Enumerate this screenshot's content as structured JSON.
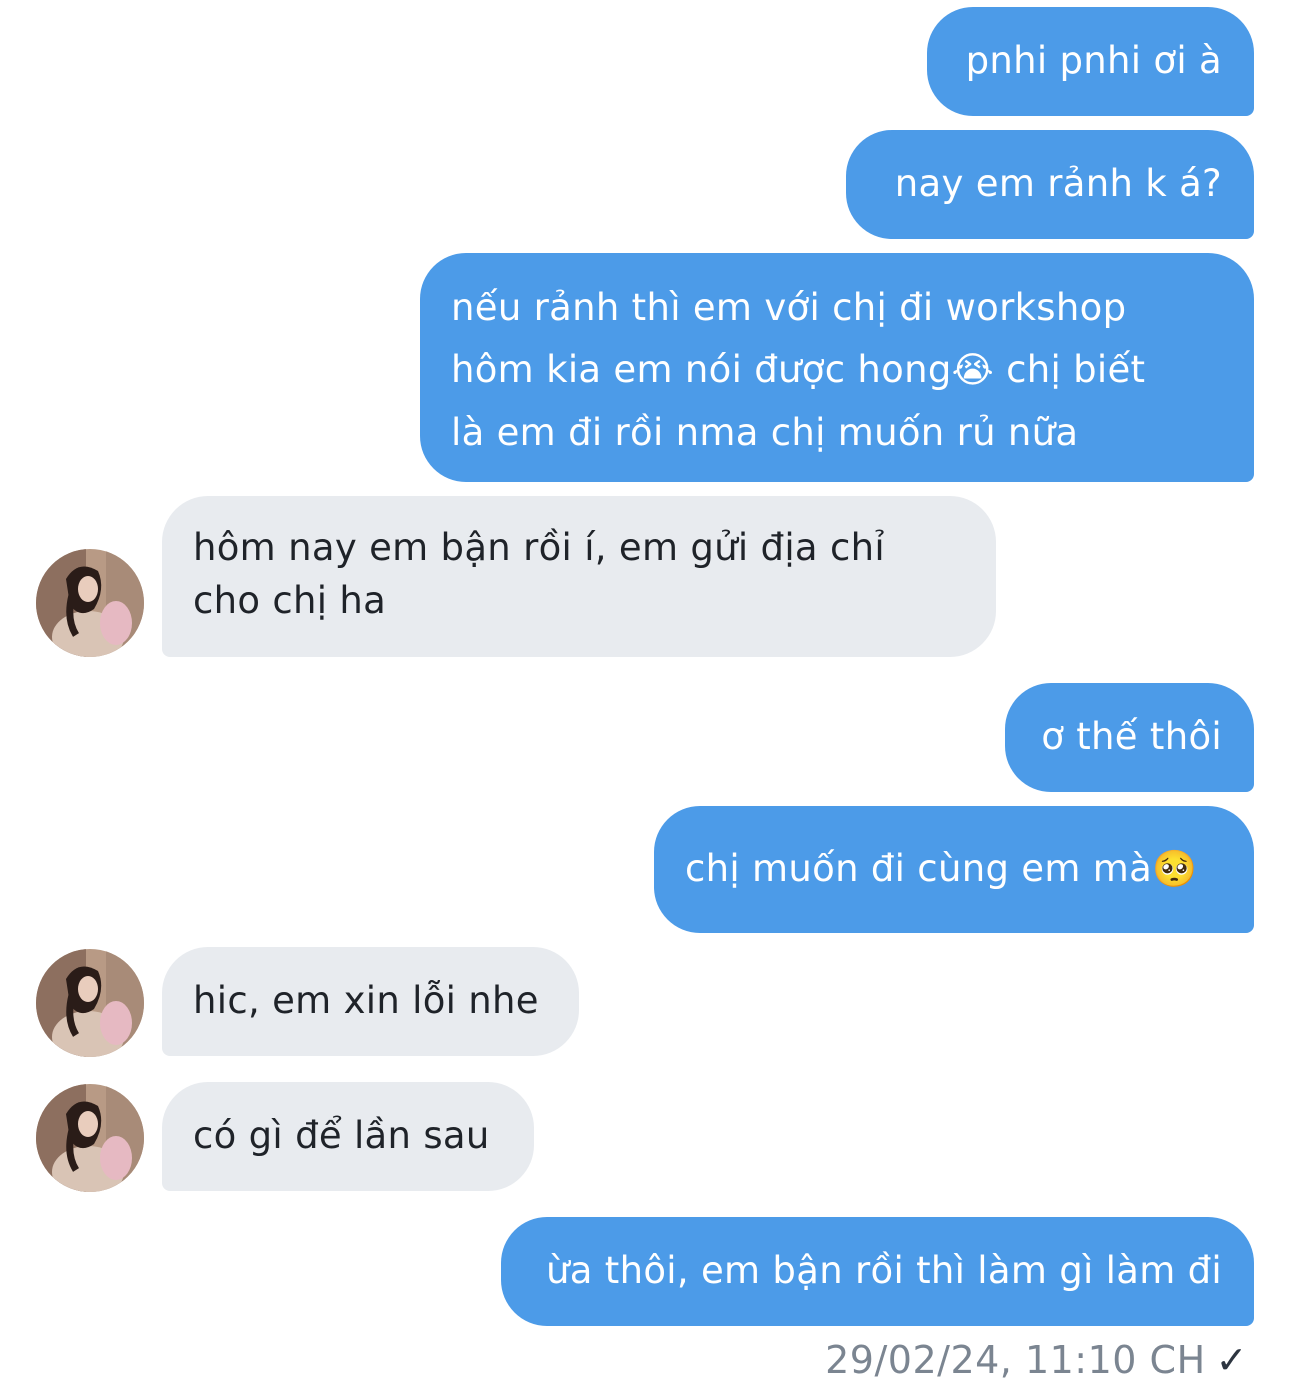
{
  "messages": [
    {
      "from": "me",
      "text": "pnhi pnhi ơi à"
    },
    {
      "from": "me",
      "text": "nay em rảnh k á?"
    },
    {
      "from": "me",
      "lines": [
        "nếu rảnh thì em với chị đi workshop",
        "hôm kia em nói được hong",
        "  chị biết",
        "là em đi rồi nma chị muốn rủ nữa"
      ],
      "emoji": "😭"
    },
    {
      "from": "them",
      "lines": [
        "hôm nay em bận rồi í, em gửi địa chỉ",
        "cho chị ha"
      ]
    },
    {
      "from": "me",
      "text": "ơ thế thôi"
    },
    {
      "from": "me",
      "text": "chị muốn đi cùng em mà",
      "emoji": "🥺"
    },
    {
      "from": "them",
      "text": "hic, em xin lỗi nhe"
    },
    {
      "from": "them",
      "text": "có gì để lần sau"
    },
    {
      "from": "me",
      "text": "ừa thôi, em bận rồi thì làm gì làm đi"
    }
  ],
  "footer": {
    "timestamp": "29/02/24, 11:10 CH",
    "status_icon": "✓"
  },
  "colors": {
    "outgoing": "#4c9be8",
    "incoming": "#e8ebef",
    "meta": "#7b8591"
  }
}
